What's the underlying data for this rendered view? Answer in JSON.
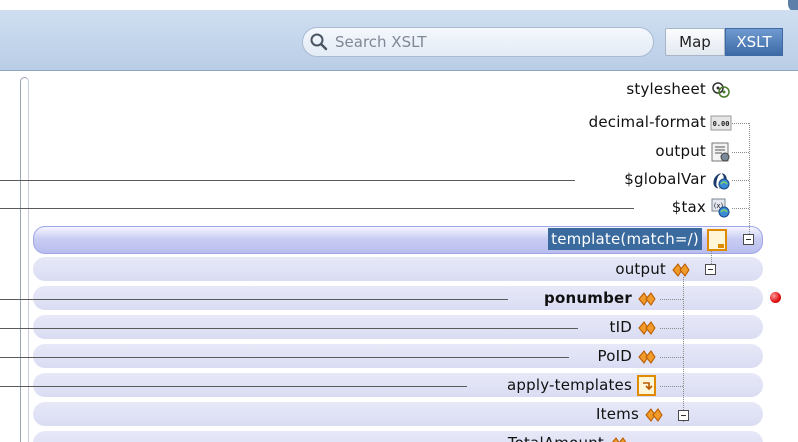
{
  "toolbar": {
    "search_placeholder": "Search XSLT",
    "map_label": "Map",
    "xslt_label": "XSLT"
  },
  "tree": {
    "nodes": [
      {
        "label": "stylesheet",
        "icon": "stylesheet-icon"
      },
      {
        "label": "decimal-format",
        "icon": "decimal-format-icon"
      },
      {
        "label": "output",
        "icon": "output-icon"
      },
      {
        "label": "$globalVar",
        "icon": "variable-icon"
      },
      {
        "label": "$tax",
        "icon": "variable-icon"
      },
      {
        "label": "template(match=/)",
        "icon": "template-icon",
        "selected": true
      },
      {
        "label": "output",
        "icon": "element-icon"
      },
      {
        "label": "ponumber",
        "icon": "element-icon",
        "bold": true,
        "error": true
      },
      {
        "label": "tID",
        "icon": "element-icon"
      },
      {
        "label": "PoID",
        "icon": "element-icon"
      },
      {
        "label": "apply-templates",
        "icon": "apply-templates-icon"
      },
      {
        "label": "Items",
        "icon": "element-icon"
      },
      {
        "label": "TotalAmount",
        "icon": "element-icon"
      }
    ]
  },
  "colors": {
    "toolbar_bg": "#c4d6ec",
    "selection_bg": "#3b6a9e",
    "band_bg": "#e0e2f6",
    "error": "#e01010"
  }
}
